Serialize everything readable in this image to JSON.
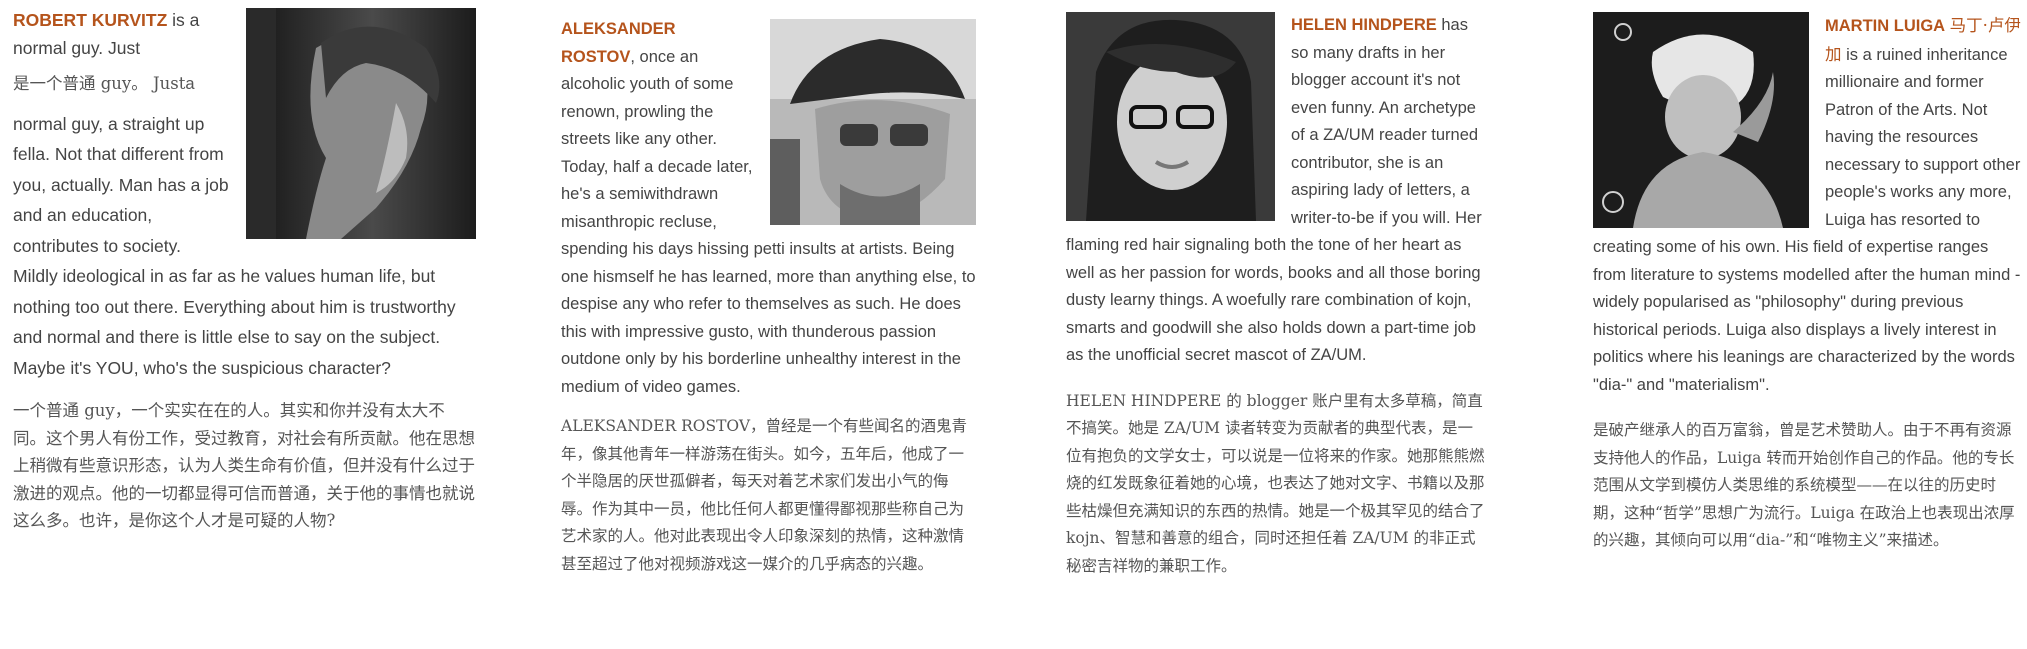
{
  "profiles": [
    {
      "name": "ROBERT KURVITZ",
      "bio_en_lead": " is a normal guy. Just",
      "bio_cn_inline": "是一个普通 guy。 Just",
      "bio_cn_inline_tail": "a",
      "bio_en_rest": "normal guy, a straight up fella. Not that different from you, actually. Man has a job and an education, contributes to society. Mildly ideological in as far as he values human life, but nothing too out there. Everything about him is trustworthy and normal and there is little else to say on the subject. Maybe it's YOU, who's the suspicious character?",
      "bio_cn": "一个普通 guy，一个实实在在的人。其实和你并没有太大不同。这个男人有份工作，受过教育，对社会有所贡献。他在思想上稍微有些意识形态，认为人类生命有价值，但并没有什么过于激进的观点。他的一切都显得可信而普通，关于他的事情也就说这么多。也许，是你这个人才是可疑的人物?",
      "photo_icon": "portrait-photo"
    },
    {
      "name": "ALEKSANDER ROSTOV",
      "bio_en": ", once an alcoholic youth of some renown, prowling the streets like any other. Today, half a decade later, he's a semiwithdrawn misanthropic recluse, spending his days hissing petti insults at artists. Being one hismself he has learned, more than anything else, to despise any who refer to themselves as such. He does this with impressive gusto, with thunderous passion outdone only by his borderline unhealthy interest in the medium of video games.",
      "bio_cn": "ALEKSANDER ROSTOV，曾经是一个有些闻名的酒鬼青年，像其他青年一样游荡在街头。如今，五年后，他成了一个半隐居的厌世孤僻者，每天对着艺术家们发出小气的侮辱。作为其中一员，他比任何人都更懂得鄙视那些称自己为艺术家的人。他对此表现出令人印象深刻的热情，这种激情甚至超过了他对视频游戏这一媒介的几乎病态的兴趣。",
      "photo_icon": "portrait-photo"
    },
    {
      "name": "HELEN HINDPERE",
      "bio_en": " has so many drafts in her blogger account it's not even funny. An archetype of a ZA/UM reader turned contributor, she is an aspiring lady of letters, a writer-to-be if you will. Her flaming red hair signaling both the tone of her heart as well as her passion for words, books and all those boring dusty learny things. A woefully rare combination of kojn, smarts and goodwill she also holds down a part-time job as the unofficial secret mascot of ZA/UM.",
      "bio_cn": "HELEN HINDPERE 的 blogger 账户里有太多草稿，简直不搞笑。她是 ZA/UM 读者转变为贡献者的典型代表，是一位有抱负的文学女士，可以说是一位将来的作家。她那熊熊燃烧的红发既象征着她的心境，也表达了她对文字、书籍以及那些枯燥但充满知识的东西的热情。她是一个极其罕见的结合了 kojn、智慧和善意的组合，同时还担任着 ZA/UM 的非正式秘密吉祥物的兼职工作。",
      "photo_icon": "portrait-photo"
    },
    {
      "name": "MARTIN LUIGA",
      "name_cn": "马丁·卢伊加",
      "bio_en": " is a ruined inheritance millionaire and former Patron of the Arts. Not having the resources necessary to support other people's works any more, Luiga has resorted to creating some of his own. His field of expertise ranges from literature to systems modelled after the human mind - widely popularised as \"philosophy\" during previous historical periods. Luiga also displays a lively interest in politics where his leanings are characterized by the words \"dia-\" and \"materialism\".",
      "bio_cn": "是破产继承人的百万富翁，曾是艺术赞助人。由于不再有资源支持他人的作品，Luiga 转而开始创作自己的作品。他的专长范围从文学到模仿人类思维的系统模型——在以往的历史时期，这种“哲学”思想广为流行。Luiga 在政治上也表现出浓厚的兴趣，其倾向可以用“dia-”和“唯物主义”来描述。",
      "photo_icon": "portrait-photo"
    }
  ]
}
